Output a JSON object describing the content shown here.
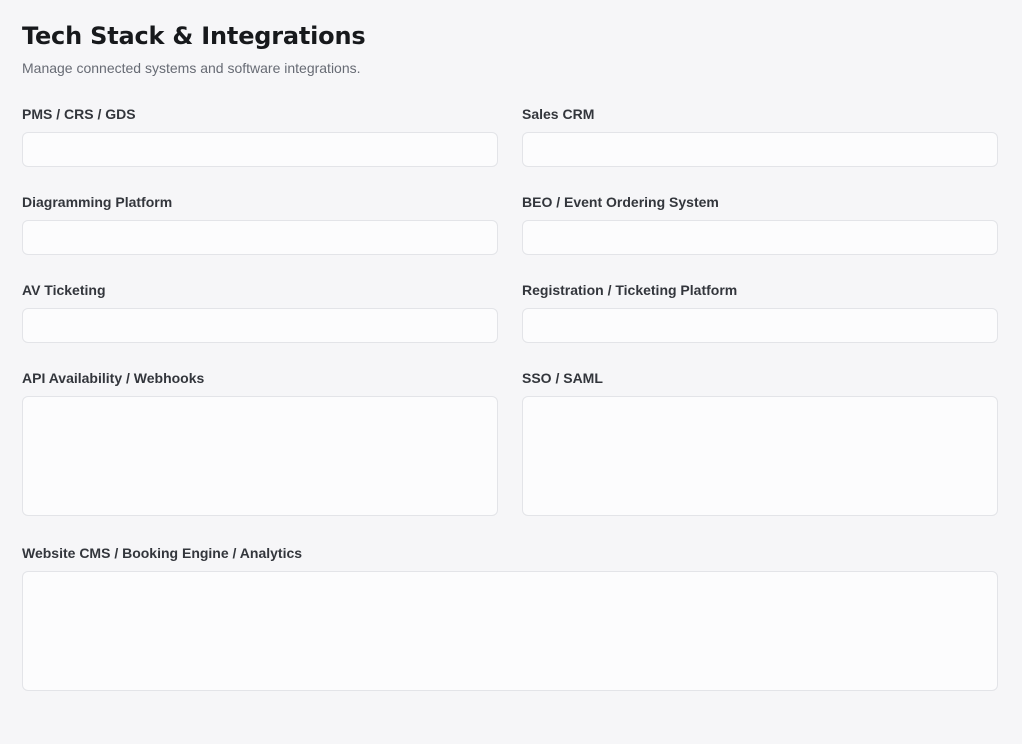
{
  "header": {
    "title": "Tech Stack & Integrations",
    "subtitle": "Manage connected systems and software integrations."
  },
  "fields": {
    "pms": {
      "label": "PMS / CRS / GDS",
      "value": "",
      "placeholder": ""
    },
    "sales_crm": {
      "label": "Sales CRM",
      "value": "",
      "placeholder": ""
    },
    "diagramming": {
      "label": "Diagramming Platform",
      "value": "",
      "placeholder": ""
    },
    "beo": {
      "label": "BEO / Event Ordering System",
      "value": "",
      "placeholder": ""
    },
    "av_ticketing": {
      "label": "AV Ticketing",
      "value": "",
      "placeholder": ""
    },
    "registration": {
      "label": "Registration / Ticketing Platform",
      "value": "",
      "placeholder": ""
    },
    "api": {
      "label": "API Availability / Webhooks",
      "value": "",
      "placeholder": ""
    },
    "sso": {
      "label": "SSO / SAML",
      "value": "",
      "placeholder": ""
    },
    "website_cms": {
      "label": "Website CMS / Booking Engine / Analytics",
      "value": "",
      "placeholder": ""
    }
  }
}
